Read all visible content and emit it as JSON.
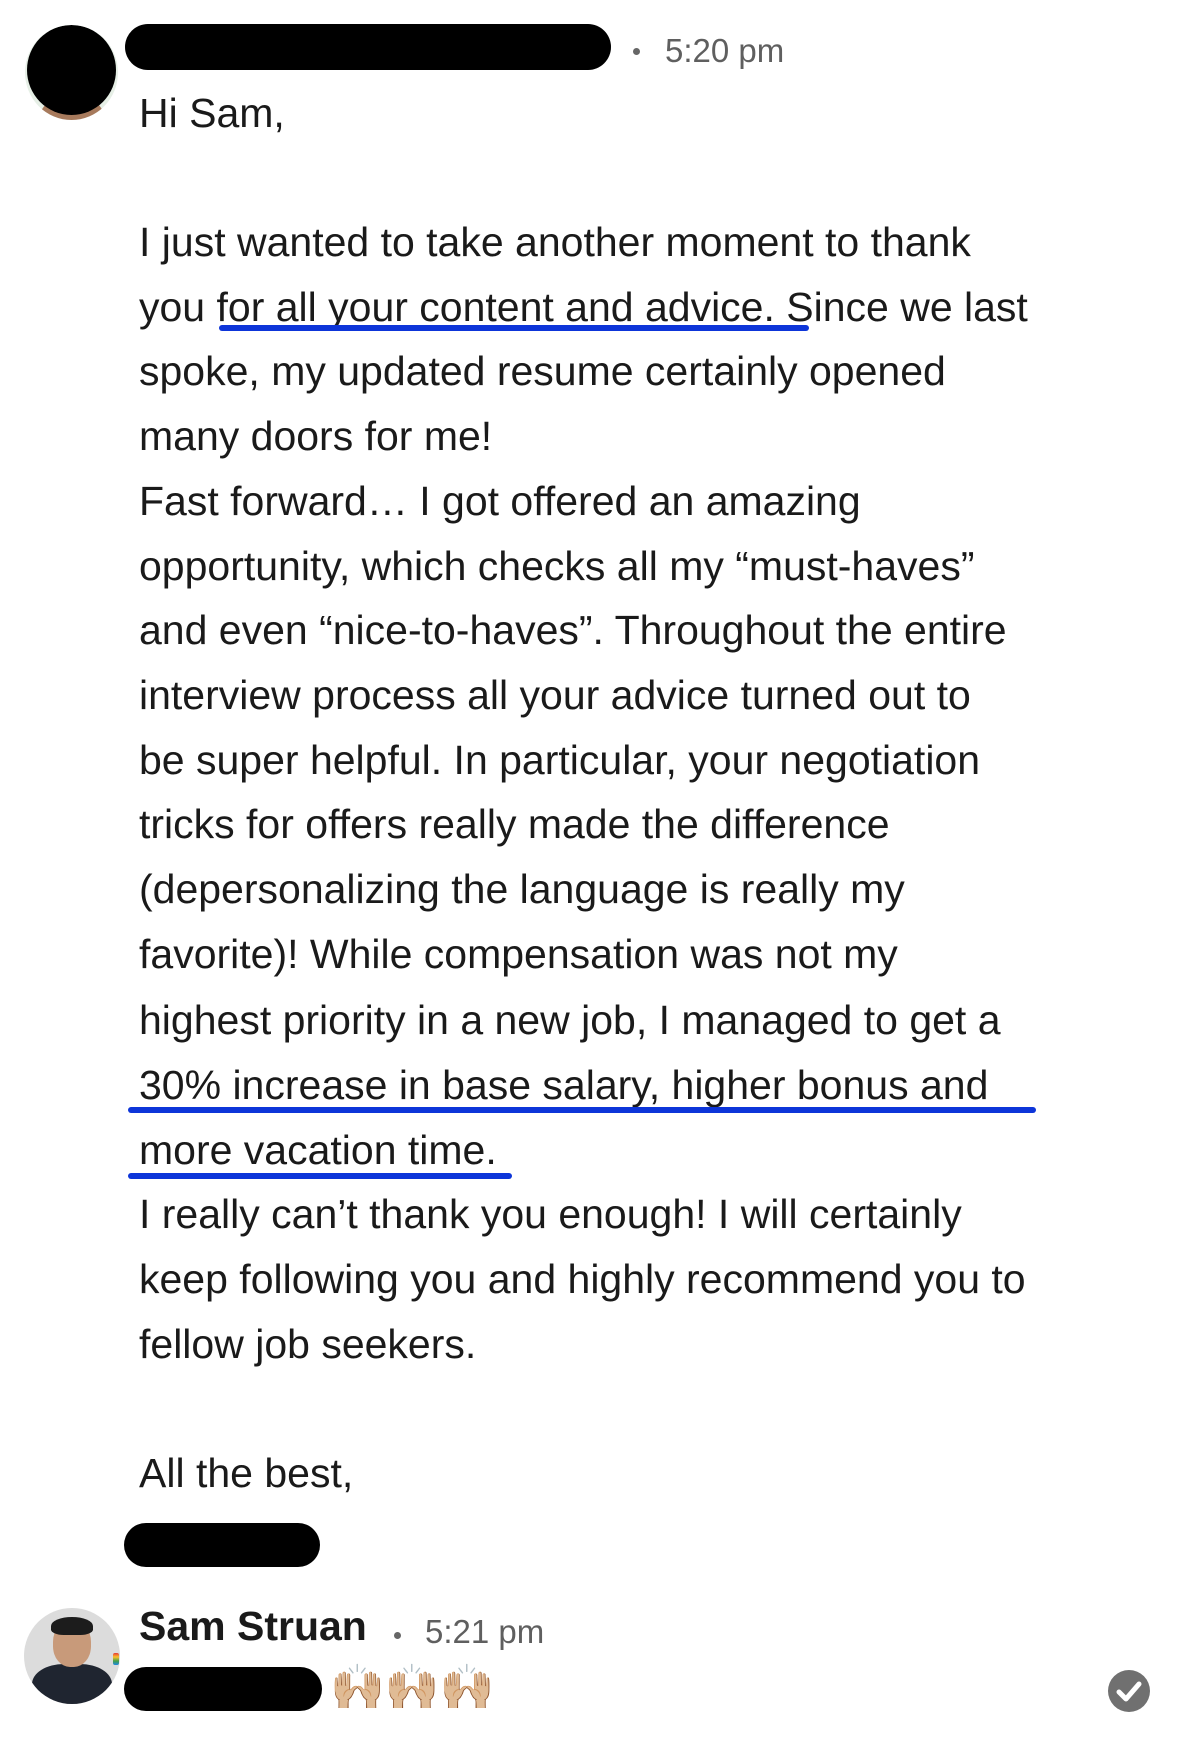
{
  "message_1": {
    "time": "5:20 pm",
    "lines": [
      "Hi Sam,",
      "I just wanted to take another moment to thank",
      "you for all your content and advice. Since we last",
      "spoke, my updated resume certainly opened",
      "many doors for me!",
      "Fast forward… I got offered an amazing",
      "opportunity, which checks all my “must-haves”",
      "and even “nice-to-haves”. Throughout the entire",
      "interview process all your advice turned out to",
      "be super helpful. In particular, your negotiation",
      "tricks for offers really made the difference",
      "(depersonalizing the language is really my",
      "favorite)! While compensation was not my",
      "highest priority in a new job, I managed to get a",
      "30% increase in base salary, higher bonus and",
      "more vacation time.",
      "I really can’t thank you enough! I will certainly",
      "keep following you and highly recommend you to",
      "fellow job seekers.",
      "All the best,"
    ]
  },
  "message_2": {
    "sender": "Sam Struan",
    "time": "5:21 pm",
    "reaction": "🙌🏼🙌🏼🙌🏼"
  },
  "colors": {
    "underline": "#0d35d9",
    "redaction": "#000000",
    "timestamp": "#5f5f5f"
  },
  "icons": {
    "read_receipt": "check-circle-icon"
  }
}
